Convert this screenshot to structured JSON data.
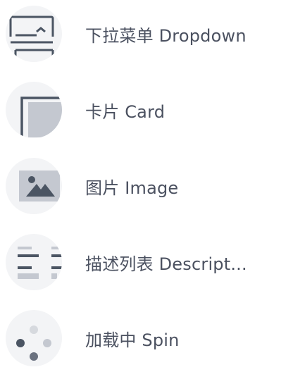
{
  "items": [
    {
      "label": "下拉菜单 Dropdown",
      "icon": "dropdown-icon"
    },
    {
      "label": "卡片 Card",
      "icon": "card-icon"
    },
    {
      "label": "图片 Image",
      "icon": "image-icon"
    },
    {
      "label": "描述列表 Descript...",
      "icon": "descriptions-icon"
    },
    {
      "label": "加载中 Spin",
      "icon": "spin-icon"
    }
  ],
  "colors": {
    "dark": "#4b5563",
    "light": "#c4c8d0",
    "circle": "#f3f4f6",
    "text": "#4b5160"
  }
}
